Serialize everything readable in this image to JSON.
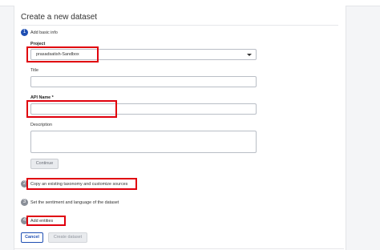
{
  "dialog": {
    "title": "Create a new dataset"
  },
  "steps": [
    {
      "number": "1",
      "label": "Add basic info"
    },
    {
      "number": "2",
      "label": "Copy an existing taxonomy and customize sources"
    },
    {
      "number": "3",
      "label": "Set the sentiment and language of the dataset"
    },
    {
      "number": "4",
      "label": "Add entities"
    }
  ],
  "form": {
    "project_label": "Project",
    "project_value": "prasadsatish-Sandbox",
    "title_label": "Title",
    "title_value": "",
    "api_name_label": "API Name *",
    "api_name_value": "",
    "description_label": "Description",
    "description_value": "",
    "continue_label": "Continue"
  },
  "footer": {
    "cancel_label": "Cancel",
    "create_label": "Create dataset"
  },
  "colors": {
    "accent": "#1f4fb3",
    "highlight": "#e0000d",
    "inactive_step": "#8a8f98"
  },
  "icons": {
    "dropdown": "chevron-down-icon"
  }
}
